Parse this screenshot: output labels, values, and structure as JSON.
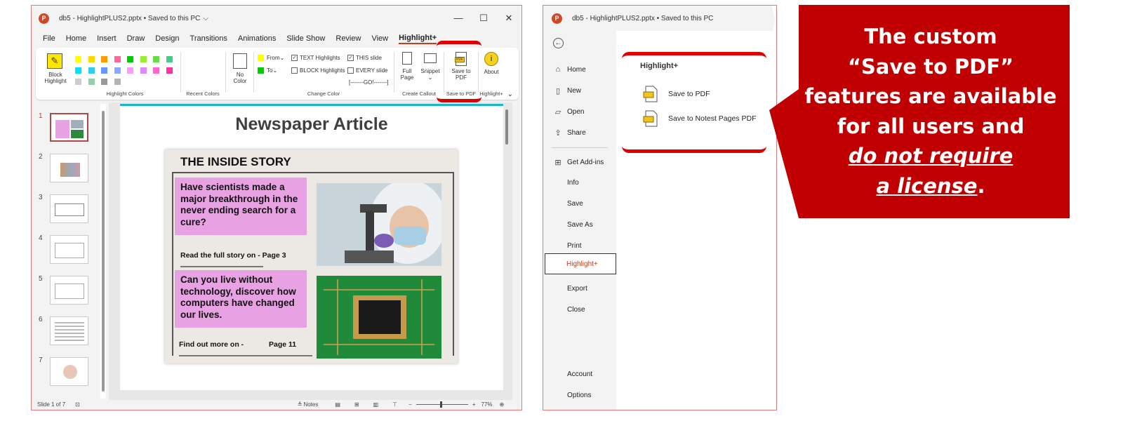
{
  "left_window": {
    "title": "db5 - HighlightPLUS2.pptx • Saved to this PC",
    "title_chevron": "⌵",
    "window_controls": [
      "—",
      "☐",
      "✕"
    ],
    "menu": [
      "File",
      "Home",
      "Insert",
      "Draw",
      "Design",
      "Transitions",
      "Animations",
      "Slide Show",
      "Review",
      "View",
      "Highlight+"
    ],
    "ribbon": {
      "block_highlight": [
        "Block",
        "Highlight"
      ],
      "highlight_colors_label": "Highlight Colors",
      "recent_colors_label": "Recent Colors",
      "no_color": [
        "No",
        "Color"
      ],
      "from_label": "From",
      "to_label": "To",
      "text_highlights": "TEXT Highlights",
      "block_highlights": "BLOCK Highlights",
      "this_slide": "THIS slide",
      "every_slide": "EVERY slide",
      "go": "[-------GO!-------]",
      "change_color_label": "Change Color",
      "full_page": [
        "Full",
        "Page"
      ],
      "snippet": "Snippet",
      "create_callout_label": "Create Callout",
      "save_to_pdf_btn": [
        "Save to",
        "PDF"
      ],
      "save_to_pdf_label": "Save to PDF",
      "about": "About",
      "highlight_plus_label": "Highlight+",
      "pdf_badge": "PDF",
      "swatch_colors": [
        "#ffff00",
        "#ffd800",
        "#ff9900",
        "#ff6699",
        "#00cc00",
        "#99ee33",
        "#66dd44",
        "#44cc88",
        "#00e5ff",
        "#33ccee",
        "#6699ff",
        "#88aaff",
        "#ff99ff",
        "#dd88ff",
        "#ff66cc",
        "#ff3399",
        "#cccccc",
        "#99ccaa",
        "#999999",
        "#b3b3b3"
      ]
    },
    "thumb_numbers": [
      "1",
      "2",
      "3",
      "4",
      "5",
      "6",
      "7"
    ],
    "slide": {
      "title": "Newspaper Article",
      "headline": "THE INSIDE STORY",
      "box1": "Have scientists made a major breakthrough in the never ending search for a cure?",
      "line1": "Read the full story on -  Page 3",
      "box2": "Can you live without technology, discover how computers have changed our lives.",
      "line2_left": "Find out more on -",
      "line2_right": "Page 11"
    },
    "status": {
      "slide_count": "Slide 1 of 7",
      "notes": "Notes",
      "zoom": "77%"
    }
  },
  "right_window": {
    "title": "db5 - HighlightPLUS2.pptx • Saved to this PC",
    "nav_top": [
      {
        "label": "Home",
        "icon": "home-icon"
      },
      {
        "label": "New",
        "icon": "new-icon"
      },
      {
        "label": "Open",
        "icon": "open-icon"
      },
      {
        "label": "Share",
        "icon": "share-icon"
      },
      {
        "label": "Get Add-ins",
        "icon": "addins-icon"
      }
    ],
    "nav_plain": [
      "Info",
      "Save",
      "Save As",
      "Print",
      "Highlight+",
      "Export",
      "Close"
    ],
    "nav_bottom": [
      "Account",
      "Options"
    ],
    "section_title": "Highlight+",
    "actions": [
      "Save to PDF",
      "Save to Notest Pages PDF"
    ]
  },
  "callout": {
    "lines": [
      "The custom",
      "“Save to PDF”",
      "features are available",
      "for all users and"
    ],
    "em_lines": [
      "do not require",
      "a license"
    ],
    "period": ".",
    "color": "#c00000"
  }
}
